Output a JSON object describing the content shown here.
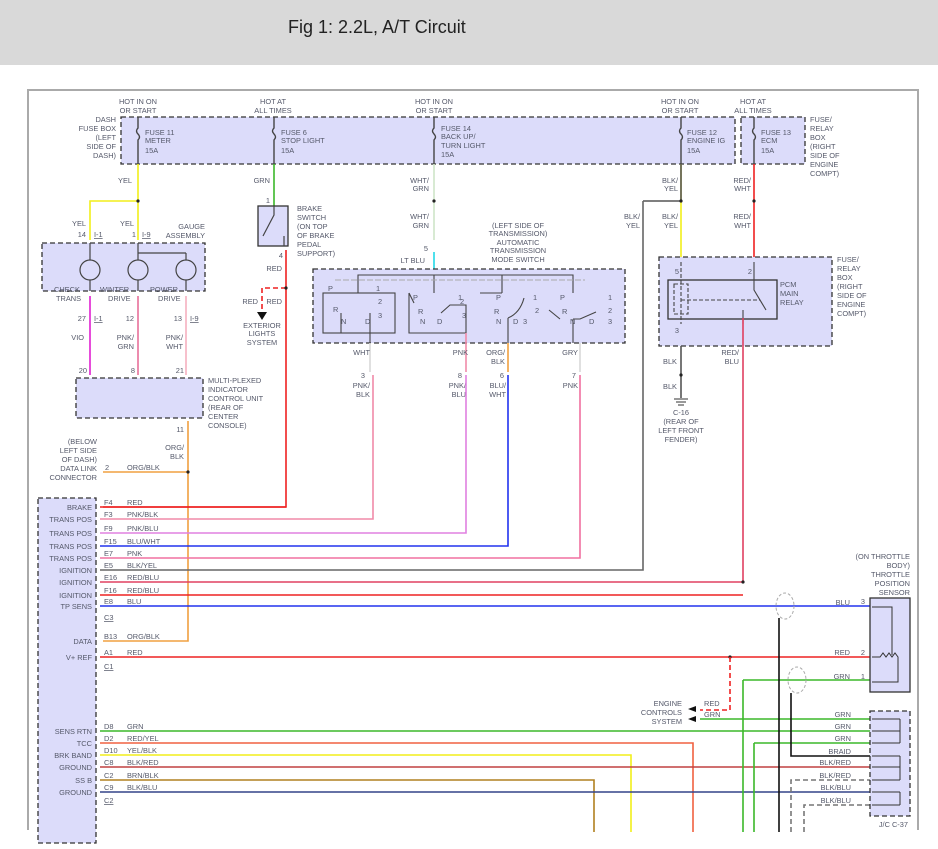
{
  "header": {
    "title": "Fig 1: 2.2L, A/T Circuit"
  },
  "fuses": {
    "dash_box": [
      "DASH",
      "FUSE BOX",
      "(LEFT",
      "SIDE OF",
      "DASH)"
    ],
    "relay_box": [
      "FUSE/",
      "RELAY",
      "BOX",
      "(RIGHT",
      "SIDE OF",
      "ENGINE",
      "COMPT)"
    ],
    "hot_on_start": [
      "HOT IN ON",
      "OR START"
    ],
    "hot_all_times": [
      "HOT AT",
      "ALL TIMES"
    ],
    "fuse11": [
      "FUSE 11",
      "METER",
      "15A"
    ],
    "fuse6": [
      "FUSE 6",
      "STOP LIGHT",
      "15A"
    ],
    "fuse14": [
      "FUSE 14",
      "BACK UP/",
      "TURN LIGHT",
      "15A"
    ],
    "fuse12": [
      "FUSE 12",
      "ENGINE IG",
      "15A"
    ],
    "fuse13": [
      "FUSE 13",
      "ECM",
      "15A"
    ]
  },
  "gauge": {
    "title": [
      "GAUGE",
      "ASSEMBLY"
    ],
    "check": [
      "CHECK",
      "TRANS"
    ],
    "winter": [
      "WINTER",
      "DRIVE"
    ],
    "power": [
      "POWER",
      "DRIVE"
    ],
    "pins": [
      "14",
      "1",
      "27",
      "12",
      "13"
    ],
    "conn": [
      "I-1",
      "I-9",
      "I-1",
      "I-9"
    ]
  },
  "wires": {
    "yel": "YEL",
    "grn": "GRN",
    "wht_grn": [
      "WHT/",
      "GRN"
    ],
    "lt_blu": "LT BLU",
    "red": "RED",
    "vio": "VIO",
    "pnk_grn": [
      "PNK/",
      "GRN"
    ],
    "pnk_wht": [
      "PNK/",
      "WHT"
    ],
    "blk_yel": [
      "BLK/",
      "YEL"
    ],
    "red_wht": [
      "RED/",
      "WHT"
    ],
    "blk": "BLK",
    "red_blu": [
      "RED/",
      "BLU"
    ],
    "wht": "WHT",
    "pnk": "PNK",
    "org_blk": [
      "ORG/",
      "BLK"
    ],
    "gry": "GRY",
    "pnk_blk": [
      "PNK/",
      "BLK"
    ],
    "pnk_blu": [
      "PNK/",
      "BLU"
    ],
    "blu_wht": [
      "BLU/",
      "WHT"
    ]
  },
  "brake_switch": [
    "BRAKE",
    "SWITCH",
    "(ON TOP",
    "OF BRAKE",
    "PEDAL",
    "SUPPORT)"
  ],
  "brake_pins": [
    "1",
    "4"
  ],
  "exterior": [
    "EXTERIOR",
    "LIGHTS",
    "SYSTEM"
  ],
  "mode_switch": {
    "title": [
      "(LEFT SIDE OF",
      "TRANSMISSION)",
      "AUTOMATIC",
      "TRANSMISSION",
      "MODE SWITCH"
    ],
    "pins": [
      "5",
      "3",
      "8",
      "6",
      "7"
    ],
    "positions": [
      "P",
      "R",
      "N",
      "D",
      "1",
      "2",
      "3"
    ]
  },
  "relay": {
    "title": [
      "PCM",
      "MAIN",
      "RELAY"
    ],
    "pins": [
      "5",
      "2",
      "3"
    ]
  },
  "ground": [
    "C-16",
    "(REAR OF",
    "LEFT FRONT",
    "FENDER)"
  ],
  "micu": {
    "title": [
      "MULTI-PLEXED",
      "INDICATOR",
      "CONTROL UNIT",
      "(REAR OF",
      "CENTER",
      "CONSOLE)"
    ],
    "pins": [
      "20",
      "8",
      "21",
      "11"
    ]
  },
  "dlc": {
    "title": [
      "(BELOW",
      "LEFT SIDE",
      "OF DASH)",
      "DATA LINK",
      "CONNECTOR"
    ],
    "pin": "2",
    "wire": "ORG/BLK"
  },
  "pcm_pins": [
    {
      "func": "BRAKE",
      "pin": "F4",
      "wire": "RED"
    },
    {
      "func": "TRANS POS",
      "pin": "F3",
      "wire": "PNK/BLK"
    },
    {
      "func": "TRANS POS",
      "pin": "F9",
      "wire": "PNK/BLU"
    },
    {
      "func": "TRANS POS",
      "pin": "F15",
      "wire": "BLU/WHT"
    },
    {
      "func": "TRANS POS",
      "pin": "E7",
      "wire": "PNK"
    },
    {
      "func": "IGNITION",
      "pin": "E5",
      "wire": "BLK/YEL"
    },
    {
      "func": "IGNITION",
      "pin": "E16",
      "wire": "RED/BLU"
    },
    {
      "func": "IGNITION",
      "pin": "F16",
      "wire": "RED/BLU"
    },
    {
      "func": "TP SENS",
      "pin": "E8",
      "wire": "BLU"
    },
    {
      "func": "DATA",
      "pin": "B13",
      "wire": "ORG/BLK"
    },
    {
      "func": "V+ REF",
      "pin": "A1",
      "wire": "RED"
    },
    {
      "func": "SENS RTN",
      "pin": "D8",
      "wire": "GRN"
    },
    {
      "func": "TCC",
      "pin": "D2",
      "wire": "RED/YEL"
    },
    {
      "func": "BRK BAND",
      "pin": "D10",
      "wire": "YEL/BLK"
    },
    {
      "func": "GROUND",
      "pin": "C8",
      "wire": "BLK/RED"
    },
    {
      "func": "SS B",
      "pin": "C2",
      "wire": "BRN/BLK"
    },
    {
      "func": "GROUND",
      "pin": "C9",
      "wire": "BLK/BLU"
    }
  ],
  "pcm_conns": [
    "C3",
    "C1",
    "C2"
  ],
  "tps": {
    "title": [
      "(ON THROTTLE",
      "BODY)",
      "THROTTLE",
      "POSITION",
      "SENSOR"
    ],
    "pins": [
      "3",
      "2",
      "1"
    ],
    "wires": [
      "BLU",
      "RED",
      "GRN"
    ]
  },
  "engine_controls": {
    "title": [
      "ENGINE",
      "CONTROLS",
      "SYSTEM"
    ],
    "wires": [
      "RED",
      "GRN"
    ]
  },
  "jc": {
    "title": "J/C C-37",
    "wires": [
      "GRN",
      "GRN",
      "GRN",
      "BRAID",
      "BLK/RED",
      "BLK/RED",
      "BLK/BLU",
      "BLK/BLU"
    ]
  },
  "colors": {
    "yel": "#f2ee1a",
    "grn": "#3cb82a",
    "red": "#ee2222",
    "vio": "#e020d0",
    "pnk": "#f08aa8",
    "blu": "#2233ee",
    "org": "#f0a040",
    "box": "#dcdcfa"
  }
}
